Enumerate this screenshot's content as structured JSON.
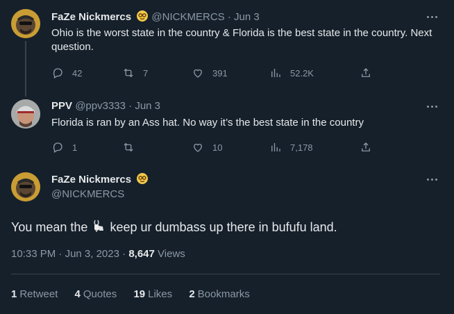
{
  "tweet1": {
    "name": "FaZe Nickmercs",
    "handle": "@NICKMERCS",
    "dot": "·",
    "date": "Jun 3",
    "text": "Ohio is the worst state in the country & Florida is the best state in the country. Next question.",
    "replies": "42",
    "retweets": "7",
    "likes": "391",
    "views": "52.2K"
  },
  "tweet2": {
    "name": "PPV",
    "handle": "@ppv3333",
    "dot": "·",
    "date": "Jun 3",
    "text": "Florida is ran by an Ass hat. No way it’s the best state in the country",
    "replies": "1",
    "retweets": "",
    "likes": "10",
    "views": "7,178"
  },
  "main_tweet": {
    "name": "FaZe Nickmercs",
    "handle": "@NICKMERCS",
    "text_before": "You mean the",
    "text_after": "keep ur dumbass up there in bufufu land.",
    "time": "10:33 PM",
    "dot": "·",
    "date": "Jun 3, 2023",
    "views_count": "8,647",
    "views_label": "Views"
  },
  "stats": {
    "retweets_count": "1",
    "retweets_label": "Retweet",
    "quotes_count": "4",
    "quotes_label": "Quotes",
    "likes_count": "19",
    "likes_label": "Likes",
    "bookmarks_count": "2",
    "bookmarks_label": "Bookmarks"
  },
  "colors": {
    "background": "#15202b",
    "text": "#e7e9ea",
    "muted": "#8b98a5",
    "divider": "#38444d",
    "badge": "#f4c84b"
  },
  "icons": [
    "reply-icon",
    "retweet-icon",
    "like-icon",
    "views-icon",
    "share-icon",
    "more-icon",
    "verified-badge-icon",
    "goat-emoji-icon"
  ]
}
